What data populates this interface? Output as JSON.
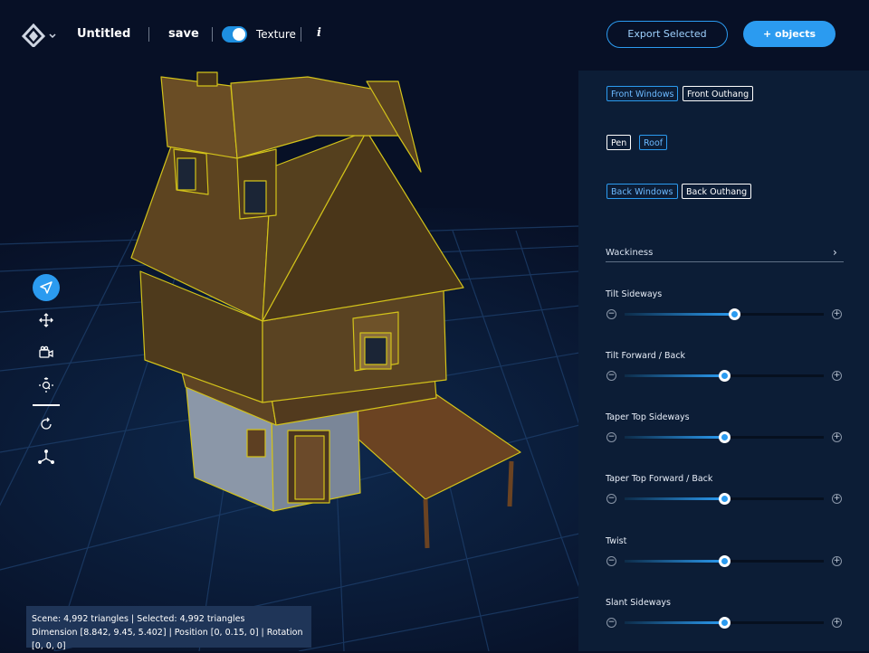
{
  "topbar": {
    "title": "Untitled",
    "save_label": "save",
    "texture_label": "Texture",
    "texture_on": true,
    "info_label": "i",
    "export_label": "Export Selected",
    "add_objects_label": "+ objects"
  },
  "colors": {
    "accent": "#2b9bf0",
    "panel": "#0c1d36",
    "background": "#071026",
    "status_bg": "#1f3558"
  },
  "toolbar": {
    "tools": [
      "select-arrow-icon",
      "move-icon",
      "camera-icon",
      "focus-zoom-icon",
      "rotate-icon",
      "axes-icon"
    ],
    "active": "select-arrow-icon"
  },
  "status": {
    "line1": "Scene: 4,992 triangles | Selected: 4,992 triangles",
    "line2": "Dimension [8.842, 9.45, 5.402] | Position [0, 0.15, 0] | Rotation [0, 0, 0]"
  },
  "panel": {
    "chip_rows": [
      [
        "Front Windows",
        "Front Outhang"
      ],
      [
        "Pen",
        "Roof"
      ],
      [
        "Back Windows",
        "Back Outhang"
      ]
    ],
    "wackiness_label": "Wackiness",
    "sliders": [
      {
        "label": "Tilt Sideways",
        "value": 0.55
      },
      {
        "label": "Tilt Forward / Back",
        "value": 0.5
      },
      {
        "label": "Taper Top Sideways",
        "value": 0.5
      },
      {
        "label": "Taper Top Forward / Back",
        "value": 0.5
      },
      {
        "label": "Twist",
        "value": 0.5
      },
      {
        "label": "Slant Sideways",
        "value": 0.5
      }
    ],
    "minus": "−",
    "plus": "+"
  }
}
